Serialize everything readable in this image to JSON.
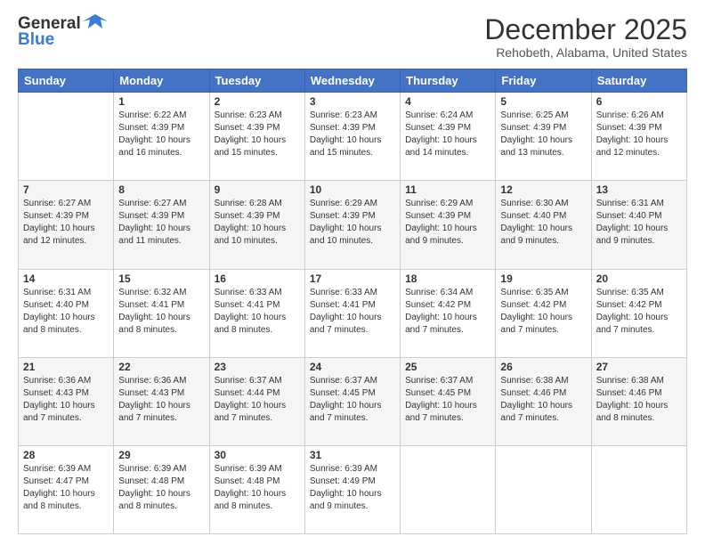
{
  "header": {
    "logo_line1": "General",
    "logo_line2": "Blue",
    "title": "December 2025",
    "subtitle": "Rehobeth, Alabama, United States"
  },
  "days_of_week": [
    "Sunday",
    "Monday",
    "Tuesday",
    "Wednesday",
    "Thursday",
    "Friday",
    "Saturday"
  ],
  "weeks": [
    [
      {
        "day": "",
        "info": ""
      },
      {
        "day": "1",
        "info": "Sunrise: 6:22 AM\nSunset: 4:39 PM\nDaylight: 10 hours\nand 16 minutes."
      },
      {
        "day": "2",
        "info": "Sunrise: 6:23 AM\nSunset: 4:39 PM\nDaylight: 10 hours\nand 15 minutes."
      },
      {
        "day": "3",
        "info": "Sunrise: 6:23 AM\nSunset: 4:39 PM\nDaylight: 10 hours\nand 15 minutes."
      },
      {
        "day": "4",
        "info": "Sunrise: 6:24 AM\nSunset: 4:39 PM\nDaylight: 10 hours\nand 14 minutes."
      },
      {
        "day": "5",
        "info": "Sunrise: 6:25 AM\nSunset: 4:39 PM\nDaylight: 10 hours\nand 13 minutes."
      },
      {
        "day": "6",
        "info": "Sunrise: 6:26 AM\nSunset: 4:39 PM\nDaylight: 10 hours\nand 12 minutes."
      }
    ],
    [
      {
        "day": "7",
        "info": "Sunrise: 6:27 AM\nSunset: 4:39 PM\nDaylight: 10 hours\nand 12 minutes."
      },
      {
        "day": "8",
        "info": "Sunrise: 6:27 AM\nSunset: 4:39 PM\nDaylight: 10 hours\nand 11 minutes."
      },
      {
        "day": "9",
        "info": "Sunrise: 6:28 AM\nSunset: 4:39 PM\nDaylight: 10 hours\nand 10 minutes."
      },
      {
        "day": "10",
        "info": "Sunrise: 6:29 AM\nSunset: 4:39 PM\nDaylight: 10 hours\nand 10 minutes."
      },
      {
        "day": "11",
        "info": "Sunrise: 6:29 AM\nSunset: 4:39 PM\nDaylight: 10 hours\nand 9 minutes."
      },
      {
        "day": "12",
        "info": "Sunrise: 6:30 AM\nSunset: 4:40 PM\nDaylight: 10 hours\nand 9 minutes."
      },
      {
        "day": "13",
        "info": "Sunrise: 6:31 AM\nSunset: 4:40 PM\nDaylight: 10 hours\nand 9 minutes."
      }
    ],
    [
      {
        "day": "14",
        "info": "Sunrise: 6:31 AM\nSunset: 4:40 PM\nDaylight: 10 hours\nand 8 minutes."
      },
      {
        "day": "15",
        "info": "Sunrise: 6:32 AM\nSunset: 4:41 PM\nDaylight: 10 hours\nand 8 minutes."
      },
      {
        "day": "16",
        "info": "Sunrise: 6:33 AM\nSunset: 4:41 PM\nDaylight: 10 hours\nand 8 minutes."
      },
      {
        "day": "17",
        "info": "Sunrise: 6:33 AM\nSunset: 4:41 PM\nDaylight: 10 hours\nand 7 minutes."
      },
      {
        "day": "18",
        "info": "Sunrise: 6:34 AM\nSunset: 4:42 PM\nDaylight: 10 hours\nand 7 minutes."
      },
      {
        "day": "19",
        "info": "Sunrise: 6:35 AM\nSunset: 4:42 PM\nDaylight: 10 hours\nand 7 minutes."
      },
      {
        "day": "20",
        "info": "Sunrise: 6:35 AM\nSunset: 4:42 PM\nDaylight: 10 hours\nand 7 minutes."
      }
    ],
    [
      {
        "day": "21",
        "info": "Sunrise: 6:36 AM\nSunset: 4:43 PM\nDaylight: 10 hours\nand 7 minutes."
      },
      {
        "day": "22",
        "info": "Sunrise: 6:36 AM\nSunset: 4:43 PM\nDaylight: 10 hours\nand 7 minutes."
      },
      {
        "day": "23",
        "info": "Sunrise: 6:37 AM\nSunset: 4:44 PM\nDaylight: 10 hours\nand 7 minutes."
      },
      {
        "day": "24",
        "info": "Sunrise: 6:37 AM\nSunset: 4:45 PM\nDaylight: 10 hours\nand 7 minutes."
      },
      {
        "day": "25",
        "info": "Sunrise: 6:37 AM\nSunset: 4:45 PM\nDaylight: 10 hours\nand 7 minutes."
      },
      {
        "day": "26",
        "info": "Sunrise: 6:38 AM\nSunset: 4:46 PM\nDaylight: 10 hours\nand 7 minutes."
      },
      {
        "day": "27",
        "info": "Sunrise: 6:38 AM\nSunset: 4:46 PM\nDaylight: 10 hours\nand 8 minutes."
      }
    ],
    [
      {
        "day": "28",
        "info": "Sunrise: 6:39 AM\nSunset: 4:47 PM\nDaylight: 10 hours\nand 8 minutes."
      },
      {
        "day": "29",
        "info": "Sunrise: 6:39 AM\nSunset: 4:48 PM\nDaylight: 10 hours\nand 8 minutes."
      },
      {
        "day": "30",
        "info": "Sunrise: 6:39 AM\nSunset: 4:48 PM\nDaylight: 10 hours\nand 8 minutes."
      },
      {
        "day": "31",
        "info": "Sunrise: 6:39 AM\nSunset: 4:49 PM\nDaylight: 10 hours\nand 9 minutes."
      },
      {
        "day": "",
        "info": ""
      },
      {
        "day": "",
        "info": ""
      },
      {
        "day": "",
        "info": ""
      }
    ]
  ]
}
